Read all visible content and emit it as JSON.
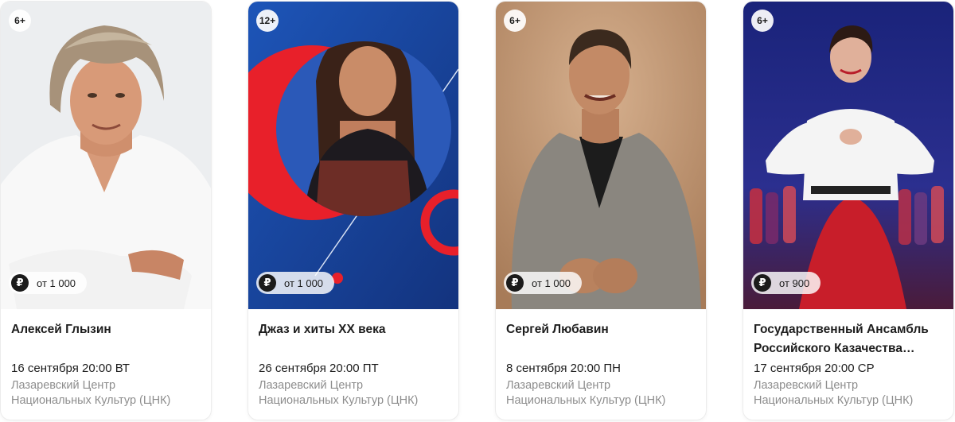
{
  "events": [
    {
      "age": "6+",
      "price": "от 1 000",
      "title": "Алексей Глызин",
      "date": "16 сентября 20:00 ВТ",
      "venue_line1": "Лазаревский Центр",
      "venue_line2": "Национальных Культур (ЦНК)"
    },
    {
      "age": "12+",
      "price": "от 1 000",
      "title": "Джаз и хиты XX века",
      "date": "26 сентября 20:00 ПТ",
      "venue_line1": "Лазаревский Центр",
      "venue_line2": "Национальных Культур (ЦНК)"
    },
    {
      "age": "6+",
      "price": "от 1 000",
      "title": "Сергей Любавин",
      "date": "8 сентября 20:00 ПН",
      "venue_line1": "Лазаревский Центр",
      "venue_line2": "Национальных Культур (ЦНК)"
    },
    {
      "age": "6+",
      "price": "от 900",
      "title_line1": "Государственный Ансамбль",
      "title_line2": "Российского Казачества…",
      "date": "17 сентября 20:00 СР",
      "venue_line1": "Лазаревский Центр",
      "venue_line2": "Национальных Культур (ЦНК)"
    }
  ],
  "currency_symbol": "₽",
  "colors": {
    "text": "#1d1d1d",
    "muted": "#8d8d8d",
    "accent_red": "#e8202a",
    "blue": "#1f46a8"
  }
}
